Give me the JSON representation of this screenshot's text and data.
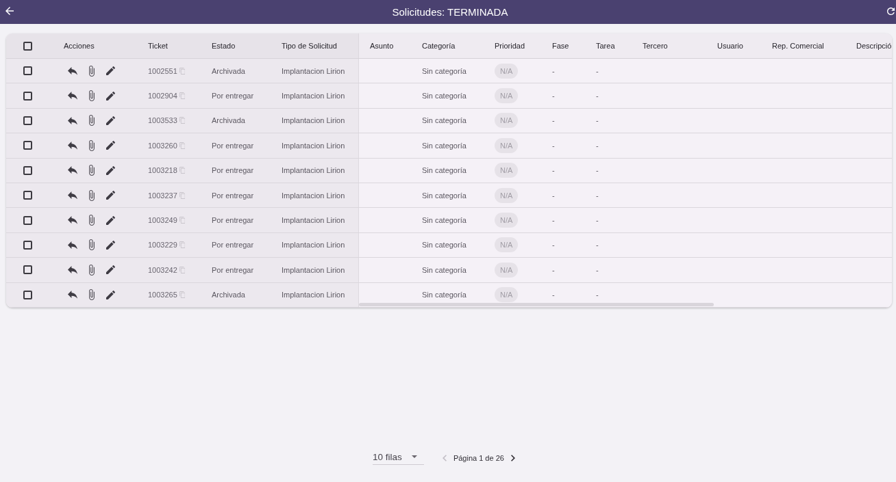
{
  "app_bar": {
    "title": "Solicitudes: TERMINADA"
  },
  "table": {
    "select_all": {
      "checked": false
    },
    "columns": [
      "Acciones",
      "Ticket",
      "Estado",
      "Tipo de Solicitud",
      "Asunto",
      "Categoría",
      "Prioridad",
      "Fase",
      "Tarea",
      "Tercero",
      "Usuario",
      "Rep. Comercial",
      "Descripció"
    ],
    "rows": [
      {
        "checked": false,
        "ticket": "1002551",
        "estado": "Archivada",
        "tipo_de_solicitud": "Implantacion Lirion",
        "categoria": "Sin categoría",
        "prioridad": "N/A",
        "fase": "-",
        "tarea": "-"
      },
      {
        "checked": false,
        "ticket": "1002904",
        "estado": "Por entregar",
        "tipo_de_solicitud": "Implantacion Lirion",
        "categoria": "Sin categoría",
        "prioridad": "N/A",
        "fase": "-",
        "tarea": "-"
      },
      {
        "checked": false,
        "ticket": "1003533",
        "estado": "Archivada",
        "tipo_de_solicitud": "Implantacion Lirion",
        "categoria": "Sin categoría",
        "prioridad": "N/A",
        "fase": "-",
        "tarea": "-"
      },
      {
        "checked": false,
        "ticket": "1003260",
        "estado": "Por entregar",
        "tipo_de_solicitud": "Implantacion Lirion",
        "categoria": "Sin categoría",
        "prioridad": "N/A",
        "fase": "-",
        "tarea": "-"
      },
      {
        "checked": false,
        "ticket": "1003218",
        "estado": "Por entregar",
        "tipo_de_solicitud": "Implantacion Lirion",
        "categoria": "Sin categoría",
        "prioridad": "N/A",
        "fase": "-",
        "tarea": "-"
      },
      {
        "checked": false,
        "ticket": "1003237",
        "estado": "Por entregar",
        "tipo_de_solicitud": "Implantacion Lirion",
        "categoria": "Sin categoría",
        "prioridad": "N/A",
        "fase": "-",
        "tarea": "-"
      },
      {
        "checked": false,
        "ticket": "1003249",
        "estado": "Por entregar",
        "tipo_de_solicitud": "Implantacion Lirion",
        "categoria": "Sin categoría",
        "prioridad": "N/A",
        "fase": "-",
        "tarea": "-"
      },
      {
        "checked": false,
        "ticket": "1003229",
        "estado": "Por entregar",
        "tipo_de_solicitud": "Implantacion Lirion",
        "categoria": "Sin categoría",
        "prioridad": "N/A",
        "fase": "-",
        "tarea": "-"
      },
      {
        "checked": false,
        "ticket": "1003242",
        "estado": "Por entregar",
        "tipo_de_solicitud": "Implantacion Lirion",
        "categoria": "Sin categoría",
        "prioridad": "N/A",
        "fase": "-",
        "tarea": "-"
      },
      {
        "checked": false,
        "ticket": "1003265",
        "estado": "Archivada",
        "tipo_de_solicitud": "Implantacion Lirion",
        "categoria": "Sin categoría",
        "prioridad": "N/A",
        "fase": "-",
        "tarea": "-"
      }
    ]
  },
  "pagination": {
    "rows_per_page": "10 filas",
    "page_label": "Página 1 de 26",
    "previous_page": {
      "disabled": true
    },
    "next_page": {
      "disabled": false
    }
  }
}
